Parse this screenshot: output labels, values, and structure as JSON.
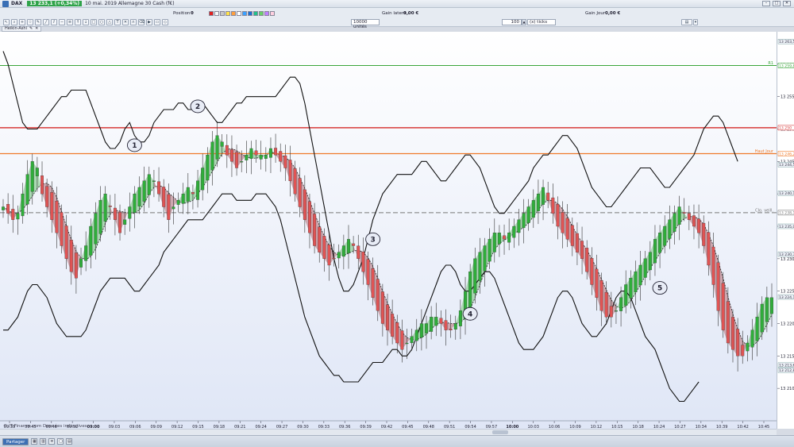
{
  "window": {
    "symbol": "DAX",
    "price_badge": "13 233,1 (+0,34%)",
    "title": "10 mai. 2019 Allemagne 30 Cash (f€)",
    "minimize": "–",
    "maximize": "□",
    "close": "✕"
  },
  "toolbar": {
    "position_label": "Position :",
    "position_value": "0",
    "gain_latent_label": "Gain latent :",
    "gain_latent_value": "0,00 €",
    "gain_jour_label": "Gain Jour :",
    "gain_jour_value": "0,00 €",
    "units_value": "10000 unités",
    "ticks_value": "100",
    "ticks_unit": "(x) ticks",
    "swatch_colors": [
      "#e02020",
      "#f7f7f7",
      "#c8c8c8",
      "#ffe24a",
      "#ff9e3d",
      "#ffffff",
      "#3aa0ff",
      "#1f6fd1",
      "#22c08a",
      "#6ad06a",
      "#c080ff",
      "#ffd0e0"
    ]
  },
  "indicator_tab": {
    "label": "Heikin-Ashi"
  },
  "chart_data": {
    "type": "candlestick",
    "title": "",
    "watermark": "© IT-Finance.com Données indicatives",
    "colors": {
      "up": "#2fae3a",
      "down": "#e05454",
      "bull_fill": "#9ed5a6",
      "bear_fill": "#c89aa2",
      "resistance": "#d83a3a",
      "pivot": "#ef7a2a",
      "r1": "#3aa63a",
      "band": "#111111"
    },
    "ylim": [
      13205,
      13265
    ],
    "y_ticks": [
      {
        "value": 13260,
        "label": "13 260"
      },
      {
        "value": 13255,
        "label": "13 255"
      },
      {
        "value": 13250,
        "label": "13 250"
      },
      {
        "value": 13245,
        "label": "13 245"
      },
      {
        "value": 13240,
        "label": "13 240"
      },
      {
        "value": 13235,
        "label": "13 235"
      },
      {
        "value": 13230,
        "label": "13 230"
      },
      {
        "value": 13225,
        "label": "13 225"
      },
      {
        "value": 13220,
        "label": "13 220"
      },
      {
        "value": 13215,
        "label": "13 215"
      },
      {
        "value": 13210,
        "label": "13 210"
      }
    ],
    "x_ticks": [
      "09:39",
      "09:45",
      "09:48",
      "09:52",
      "09:00",
      "09:03",
      "09:06",
      "09:09",
      "09:12",
      "09:15",
      "09:18",
      "09:21",
      "09:24",
      "09:27",
      "09:30",
      "09:33",
      "09:36",
      "09:39",
      "09:42",
      "09:45",
      "09:48",
      "09:51",
      "09:54",
      "09:57",
      "10:00",
      "10:03",
      "10:06",
      "10:09",
      "10:12",
      "10:15",
      "10:18",
      "10:24",
      "10:27",
      "10:34",
      "10:39",
      "10:42",
      "10:45"
    ],
    "x_ticks_bold": [
      "09:00",
      "10:00"
    ],
    "levels": [
      {
        "name": "R1",
        "value": 13259.8,
        "label": "R1",
        "style": "r1",
        "axis_label": "13 259,8"
      },
      {
        "name": "resistance",
        "value": 13250.2,
        "label": "",
        "style": "resistance",
        "axis_label": "13 250"
      },
      {
        "name": "pivot",
        "value": 13246.2,
        "label": "Haut Jour",
        "style": "pivot",
        "axis_label": "13 246,2"
      },
      {
        "name": "Clôture veille",
        "value": 13237.1,
        "label": "Clo. veill.",
        "style": "dash",
        "axis_label": "13 238,1"
      }
    ],
    "axis_badges": [
      {
        "value": 13263.5,
        "label": "13 263,5"
      },
      {
        "value": 13244.5,
        "label": "13 244,5"
      },
      {
        "value": 13240.1,
        "label": "13 240,1"
      },
      {
        "value": 13235.0,
        "label": "13 235,0"
      },
      {
        "value": 13230.7,
        "label": "13 230,7"
      },
      {
        "value": 13224.1,
        "label": "13 224,1"
      },
      {
        "value": 13213.6,
        "label": "13 213,6"
      },
      {
        "value": 13212.8,
        "label": "13 212,8"
      }
    ],
    "annotations": [
      "1",
      "2",
      "3",
      "4",
      "5"
    ],
    "annotation_points": [
      {
        "label": "1",
        "bar": 27,
        "value": 13247.5
      },
      {
        "label": "2",
        "bar": 40,
        "value": 13253.5
      },
      {
        "label": "3",
        "bar": 76,
        "value": 13233.0
      },
      {
        "label": "4",
        "bar": 96,
        "value": 13221.5
      },
      {
        "label": "5",
        "bar": 135,
        "value": 13225.5
      }
    ],
    "series_close": [
      13238,
      13237,
      13236,
      13237,
      13240,
      13243,
      13245,
      13244,
      13240,
      13238,
      13236,
      13234,
      13232,
      13230,
      13228,
      13227,
      13230,
      13232,
      13235,
      13237,
      13239,
      13240,
      13238,
      13236,
      13234,
      13236,
      13238,
      13240,
      13241,
      13242,
      13243,
      13242,
      13240,
      13238,
      13236,
      13238,
      13239,
      13240,
      13241,
      13240,
      13242,
      13244,
      13246,
      13248,
      13249,
      13248,
      13246,
      13245,
      13244,
      13245,
      13246,
      13247,
      13246,
      13246,
      13246,
      13247,
      13246,
      13245,
      13244,
      13242,
      13240,
      13238,
      13236,
      13234,
      13232,
      13231,
      13230,
      13229,
      13230,
      13231,
      13232,
      13233,
      13232,
      13230,
      13228,
      13226,
      13224,
      13222,
      13220,
      13219,
      13218,
      13217,
      13216,
      13217,
      13218,
      13219,
      13220,
      13220,
      13221,
      13221,
      13220,
      13219,
      13219,
      13220,
      13222,
      13225,
      13228,
      13230,
      13231,
      13232,
      13233,
      13234,
      13234,
      13233,
      13234,
      13235,
      13236,
      13237,
      13238,
      13239,
      13240,
      13241,
      13239,
      13237,
      13235,
      13234,
      13233,
      13232,
      13231,
      13230,
      13228,
      13226,
      13224,
      13222,
      13221,
      13221,
      13222,
      13224,
      13226,
      13227,
      13228,
      13229,
      13230,
      13231,
      13233,
      13234,
      13235,
      13236,
      13237,
      13238,
      13237,
      13236,
      13235,
      13234,
      13232,
      13229,
      13226,
      13222,
      13219,
      13217,
      13216,
      13215,
      13215,
      13217,
      13219,
      13221,
      13223,
      13224,
      13224
    ],
    "upper_band": [
      13262,
      13260,
      13257,
      13254,
      13251,
      13250,
      13250,
      13250,
      13251,
      13252,
      13253,
      13254,
      13255,
      13255,
      13256,
      13256,
      13256,
      13256,
      13254,
      13252,
      13250,
      13248,
      13247,
      13247,
      13248,
      13250,
      13251,
      13249,
      13248,
      13248,
      13249,
      13251,
      13252,
      13253,
      13253,
      13253,
      13254,
      13254,
      13253,
      13253,
      13253,
      13254,
      13253,
      13252,
      13251,
      13251,
      13252,
      13253,
      13254,
      13254,
      13255,
      13255,
      13255,
      13255,
      13255,
      13255,
      13255,
      13256,
      13257,
      13258,
      13258,
      13257,
      13254,
      13250,
      13246,
      13242,
      13238,
      13234,
      13230,
      13227,
      13225,
      13225,
      13226,
      13228,
      13230,
      13233,
      13236,
      13238,
      13240,
      13241,
      13242,
      13243,
      13243,
      13243,
      13243,
      13244,
      13245,
      13245,
      13244,
      13243,
      13242,
      13242,
      13243,
      13244,
      13245,
      13246,
      13246,
      13245,
      13244,
      13242,
      13240,
      13238,
      13237,
      13237,
      13238,
      13239,
      13240,
      13241,
      13242,
      13244,
      13245,
      13246,
      13246,
      13247,
      13248,
      13249,
      13249,
      13248,
      13247,
      13245,
      13243,
      13241,
      13240,
      13239,
      13238,
      13238,
      13239,
      13240,
      13241,
      13242,
      13243,
      13244,
      13244,
      13244,
      13243,
      13242,
      13241,
      13241,
      13242,
      13243,
      13244,
      13245,
      13246,
      13248,
      13250,
      13251,
      13252,
      13252,
      13251,
      13249,
      13247,
      13245
    ],
    "lower_band": [
      13219,
      13219,
      13220,
      13221,
      13223,
      13225,
      13226,
      13226,
      13225,
      13224,
      13222,
      13220,
      13219,
      13218,
      13218,
      13218,
      13218,
      13219,
      13221,
      13223,
      13225,
      13226,
      13227,
      13227,
      13227,
      13227,
      13226,
      13225,
      13225,
      13226,
      13227,
      13228,
      13229,
      13231,
      13232,
      13233,
      13234,
      13235,
      13236,
      13236,
      13236,
      13236,
      13237,
      13238,
      13239,
      13240,
      13240,
      13240,
      13239,
      13239,
      13239,
      13239,
      13240,
      13240,
      13240,
      13239,
      13238,
      13236,
      13233,
      13230,
      13227,
      13224,
      13221,
      13219,
      13217,
      13215,
      13214,
      13213,
      13212,
      13212,
      13211,
      13211,
      13211,
      13211,
      13212,
      13213,
      13214,
      13214,
      13214,
      13215,
      13216,
      13216,
      13215,
      13215,
      13216,
      13218,
      13220,
      13222,
      13224,
      13226,
      13228,
      13229,
      13229,
      13228,
      13226,
      13225,
      13225,
      13226,
      13227,
      13228,
      13228,
      13227,
      13225,
      13223,
      13221,
      13219,
      13217,
      13216,
      13216,
      13216,
      13217,
      13218,
      13220,
      13222,
      13224,
      13225,
      13225,
      13224,
      13222,
      13220,
      13219,
      13218,
      13218,
      13219,
      13220,
      13222,
      13224,
      13225,
      13225,
      13224,
      13222,
      13220,
      13218,
      13217,
      13216,
      13214,
      13212,
      13210,
      13209,
      13208,
      13208,
      13209,
      13210,
      13211
    ]
  },
  "statusbar": {
    "share_label": "Partager"
  }
}
